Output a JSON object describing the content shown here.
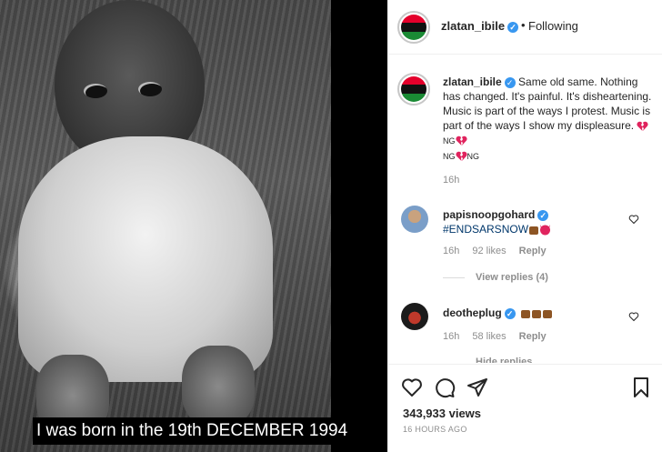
{
  "media": {
    "caption": "I was born in the 19th  DECEMBER 1994"
  },
  "header": {
    "username": "zlatan_ibile",
    "separator": "•",
    "follow_status": "Following",
    "avatar_icon": "flag-avatar-icon"
  },
  "post": {
    "username": "zlatan_ibile",
    "caption_text": " Same old same. Nothing has changed. It's painful. It's disheartening. Music is part of the ways I protest. Music is part of the ways I show my displeasure. ",
    "flag_text_1": "NG",
    "flag_text_2": "NG",
    "flag_text_3": "NG",
    "time": "16h"
  },
  "comments": [
    {
      "username": "papisnoopgohard",
      "text": "#ENDSARSNOW",
      "time": "16h",
      "likes": "92 likes",
      "reply": "Reply",
      "view_replies": "View replies (4)"
    },
    {
      "username": "deotheplug",
      "text": "",
      "time": "16h",
      "likes": "58 likes",
      "reply": "Reply",
      "hide_replies": "Hide replies"
    }
  ],
  "actions": {
    "views": "343,933 views",
    "ago": "16 HOURS AGO"
  },
  "colors": {
    "flag_red": "#e4002b",
    "flag_black": "#111111",
    "flag_green": "#1a8a34",
    "verified": "#3897f0",
    "link": "#00376b",
    "muted": "#8e8e8e"
  }
}
